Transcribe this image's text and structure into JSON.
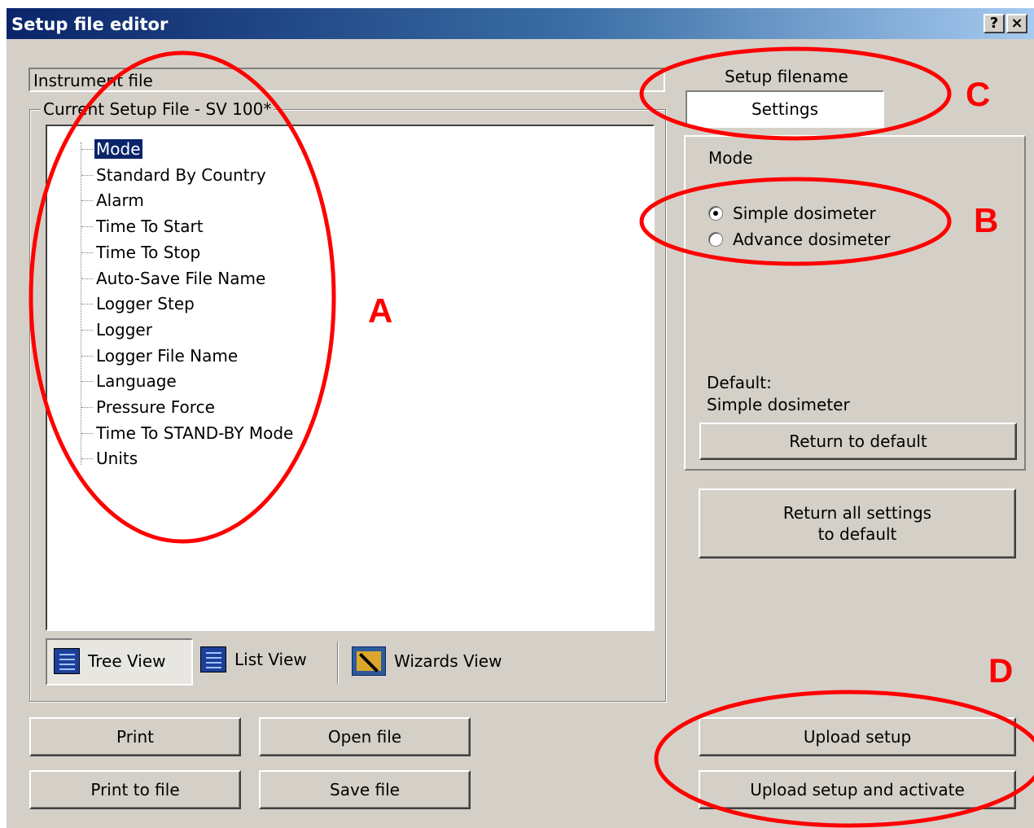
{
  "window": {
    "title": "Setup file editor",
    "help_button": "?",
    "close_button": "×"
  },
  "instrument_file": {
    "label": "Instrument file"
  },
  "setup_group": {
    "caption": "Current Setup File  - SV 100*"
  },
  "tree": {
    "items": [
      {
        "label": "Mode",
        "selected": true
      },
      {
        "label": "Standard By Country"
      },
      {
        "label": "Alarm"
      },
      {
        "label": "Time To Start"
      },
      {
        "label": "Time To Stop"
      },
      {
        "label": "Auto-Save File Name"
      },
      {
        "label": "Logger Step"
      },
      {
        "label": "Logger"
      },
      {
        "label": "Logger File Name"
      },
      {
        "label": "Language"
      },
      {
        "label": "Pressure Force"
      },
      {
        "label": "Time To STAND-BY Mode"
      },
      {
        "label": "Units"
      }
    ]
  },
  "views": {
    "tree_view": "Tree View",
    "list_view": "List View",
    "wizards_view": "Wizards View"
  },
  "right_panel": {
    "setup_filename_label": "Setup filename",
    "setup_filename_value": "Settings",
    "mode_heading": "Mode",
    "options": [
      {
        "label": "Simple dosimeter",
        "checked": true
      },
      {
        "label": "Advance dosimeter",
        "checked": false
      }
    ],
    "default_label": "Default:",
    "default_value": "Simple dosimeter",
    "return_to_default": "Return to default",
    "return_all_line1": "Return all settings",
    "return_all_line2": "to default"
  },
  "buttons": {
    "print": "Print",
    "open_file": "Open file",
    "print_to_file": "Print to file",
    "save_file": "Save file",
    "upload_setup": "Upload setup",
    "upload_activate": "Upload setup and activate"
  },
  "annotations": {
    "a": "A",
    "b": "B",
    "c": "C",
    "d": "D",
    "color": "#ff0000"
  }
}
